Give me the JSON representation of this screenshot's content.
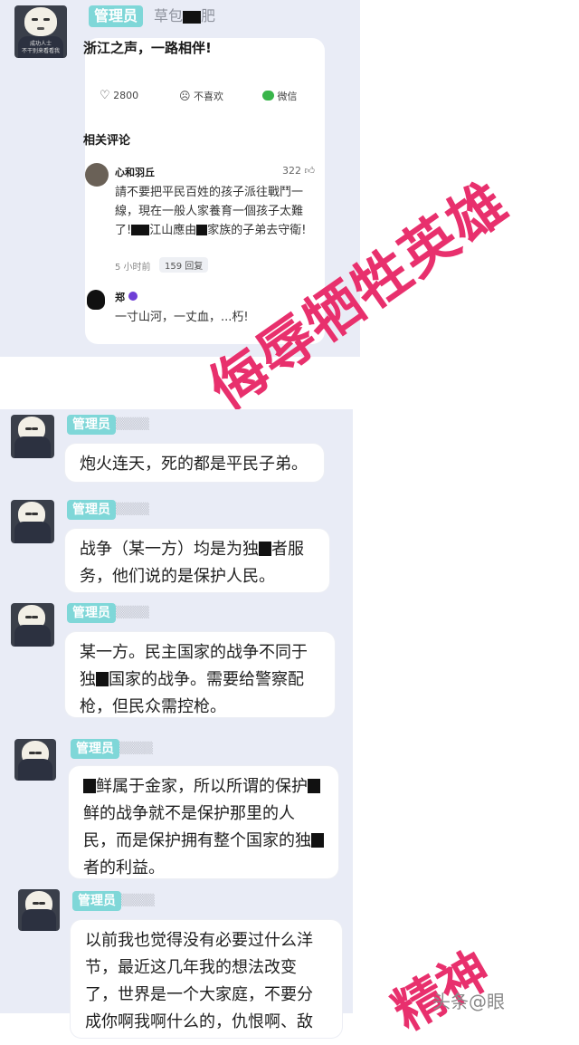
{
  "top_post": {
    "badge": "管理员",
    "nickname_prefix": "草包",
    "nickname_suffix": "肥",
    "avatar_caption_1": "成功人士",
    "avatar_caption_2": "不干别来看看我",
    "card_text": "浙江之声，一路相伴!",
    "like_count": "2800",
    "dislike_label": "不喜欢",
    "share_label": "微信",
    "related_title": "相关评论",
    "comment1": {
      "name": "心和羽丘",
      "likes": "322",
      "text_a": "請不要把平民百姓的孩子派往戰鬥一線，現在一般人家養育一個孩子太難了!",
      "text_b": "江山應由",
      "text_c": "家族的子弟去守衛!",
      "time": "5 小时前",
      "replies": "159 回复"
    },
    "comment2": {
      "name": "郑",
      "text": "一寸山河，一丈血，...朽!"
    }
  },
  "watermark": "侮辱牺牲英雄",
  "watermark2": "精神",
  "footer_watermark": "头条@眼",
  "messages": [
    {
      "badge": "管理员",
      "text": "炮火连天，死的都是平民子弟。"
    },
    {
      "badge": "管理员",
      "text_a": "战争（某一方）均是为独",
      "text_b": "者服务，他们说的是保护人民。"
    },
    {
      "badge": "管理员",
      "text_a": "某一方。民主国家的战争不同于独",
      "text_b": "国家的战争。需要给警察配枪，但民众需控枪。"
    },
    {
      "badge": "管理员",
      "text_a": "鲜属于金家，所以所谓的保护",
      "text_b": "鲜的战争就不是保护那里的人民，而是保护拥有整个国家的独",
      "text_c": "者的利益。"
    },
    {
      "badge": "管理员",
      "text": "以前我也觉得没有必要过什么洋节，最近这几年我的想法改变了，世界是一个大家庭，不要分成你啊我啊什么的，仇恨啊、敌"
    }
  ]
}
